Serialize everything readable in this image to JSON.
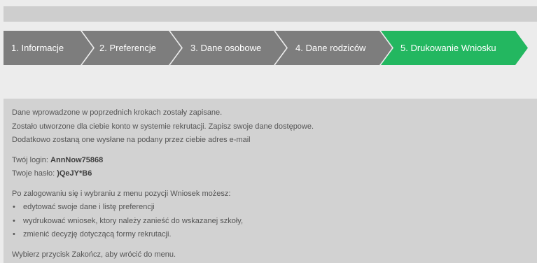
{
  "steps": [
    {
      "label": "1. Informacje",
      "active": false
    },
    {
      "label": "2. Preferencje",
      "active": false
    },
    {
      "label": "3. Dane osobowe",
      "active": false
    },
    {
      "label": "4. Dane rodziców",
      "active": false
    },
    {
      "label": "5. Drukowanie Wniosku",
      "active": true
    }
  ],
  "colors": {
    "step": "#7d7d7d",
    "step_active": "#23b760",
    "separator": "#ececec"
  },
  "message": {
    "line1": "Dane wprowadzone w poprzednich krokach zostały zapisane.",
    "line2": "Zostało utworzone dla ciebie konto w systemie rekrutacji. Zapisz swoje dane dostępowe.",
    "line3": "Dodatkowo zostaną one wysłane na podany przez ciebie adres e-mail"
  },
  "credentials": {
    "login_label": "Twój login: ",
    "login_value": "AnnNow75868",
    "password_label": "Twoje hasło: ",
    "password_value": ")QeJY*B6"
  },
  "instructions": {
    "intro": "Po zalogowaniu się i wybraniu z menu pozycji Wniosek możesz:",
    "items": [
      "edytować swoje dane i listę preferencji",
      "wydrukować wniosek, ktory należy zanieść do wskazanej szkoły,",
      "zmienić decyzję dotyczącą formy rekrutacji."
    ],
    "footer": "Wybierz przycisk Zakończ, aby wrócić do menu."
  }
}
